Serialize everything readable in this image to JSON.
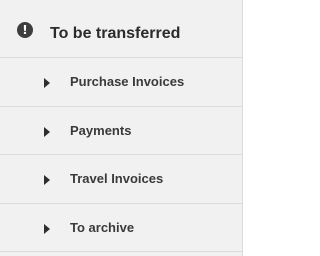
{
  "section": {
    "title": "To be transferred",
    "icon": "alert-circle-icon",
    "items": [
      {
        "label": "Purchase Invoices"
      },
      {
        "label": "Payments"
      },
      {
        "label": "Travel Invoices"
      },
      {
        "label": "To archive"
      }
    ]
  }
}
